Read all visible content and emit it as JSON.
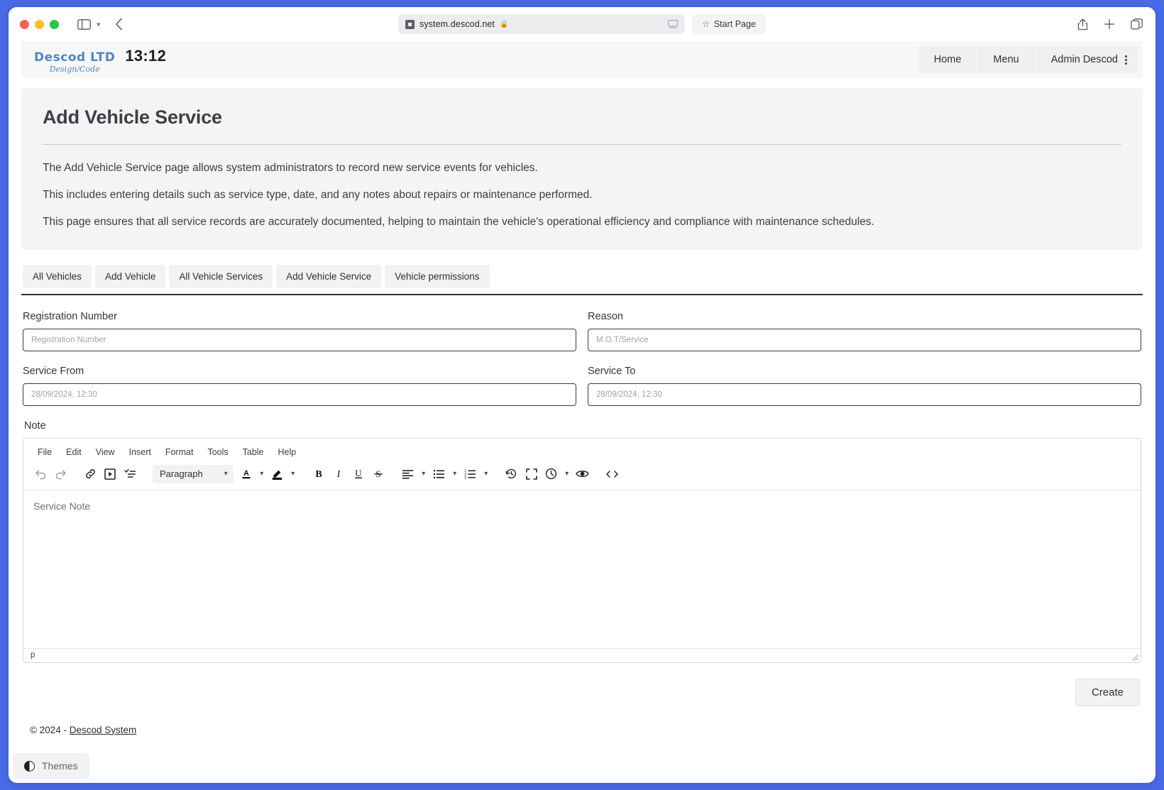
{
  "browser": {
    "url": "system.descod.net",
    "lock_icon": "lock-icon",
    "tab_label": "Start Page",
    "star_icon": "star-icon",
    "sidebar_icon": "sidebar-toggle-icon",
    "back_icon": "back-arrow-icon",
    "share_icon": "share-icon",
    "new_tab_icon": "plus-icon",
    "tab_overview_icon": "tab-overview-icon"
  },
  "app": {
    "brand_name": "Descod LTD",
    "brand_sub": "Design/Code",
    "clock": "13:12",
    "nav": [
      {
        "label": "Home"
      },
      {
        "label": "Menu"
      },
      {
        "label": "Admin Descod"
      }
    ]
  },
  "main": {
    "title": "Add Vehicle Service",
    "paragraphs": [
      "The Add Vehicle Service page allows system administrators to record new service events for vehicles.",
      "This includes entering details such as service type, date, and any notes about repairs or maintenance performed.",
      "This page ensures that all service records are accurately documented, helping to maintain the vehicle's operational efficiency and compliance with maintenance schedules."
    ],
    "tabs": [
      {
        "label": "All Vehicles"
      },
      {
        "label": "Add Vehicle"
      },
      {
        "label": "All Vehicle Services"
      },
      {
        "label": "Add Vehicle Service"
      },
      {
        "label": "Vehicle permissions"
      }
    ]
  },
  "form": {
    "registration": {
      "label": "Registration Number",
      "placeholder": "Registration Number",
      "value": ""
    },
    "reason": {
      "label": "Reason",
      "placeholder": "M.O.T/Service",
      "value": ""
    },
    "service_from": {
      "label": "Service From",
      "placeholder": "28/09/2024, 12:30",
      "value": ""
    },
    "service_to": {
      "label": "Service To",
      "placeholder": "28/09/2024, 12:30",
      "value": ""
    },
    "note": {
      "label": "Note",
      "placeholder": "Service Note",
      "value": ""
    },
    "submit_label": "Create"
  },
  "editor": {
    "menus": [
      {
        "label": "File"
      },
      {
        "label": "Edit"
      },
      {
        "label": "View"
      },
      {
        "label": "Insert"
      },
      {
        "label": "Format"
      },
      {
        "label": "Tools"
      },
      {
        "label": "Table"
      },
      {
        "label": "Help"
      }
    ],
    "format_select": "Paragraph",
    "status_path": "p",
    "toolbar_icons": [
      "undo-icon",
      "redo-icon",
      "link-icon",
      "media-icon",
      "format-painter-icon",
      "text-color-icon",
      "highlight-color-icon",
      "bold-icon",
      "italic-icon",
      "underline-icon",
      "strikethrough-icon",
      "align-left-icon",
      "bullet-list-icon",
      "numbered-list-icon",
      "restore-draft-icon",
      "fullscreen-icon",
      "insert-datetime-icon",
      "preview-icon",
      "source-code-icon"
    ]
  },
  "footer": {
    "copyright": "© 2024 - ",
    "link_label": "Descod System"
  },
  "themes": {
    "label": "Themes",
    "icon": "contrast-icon"
  },
  "colors": {
    "desktop": "#4A6BE8",
    "card_bg": "#F4F4F5",
    "brand": "#4F86C6",
    "input_border": "#373B40"
  }
}
